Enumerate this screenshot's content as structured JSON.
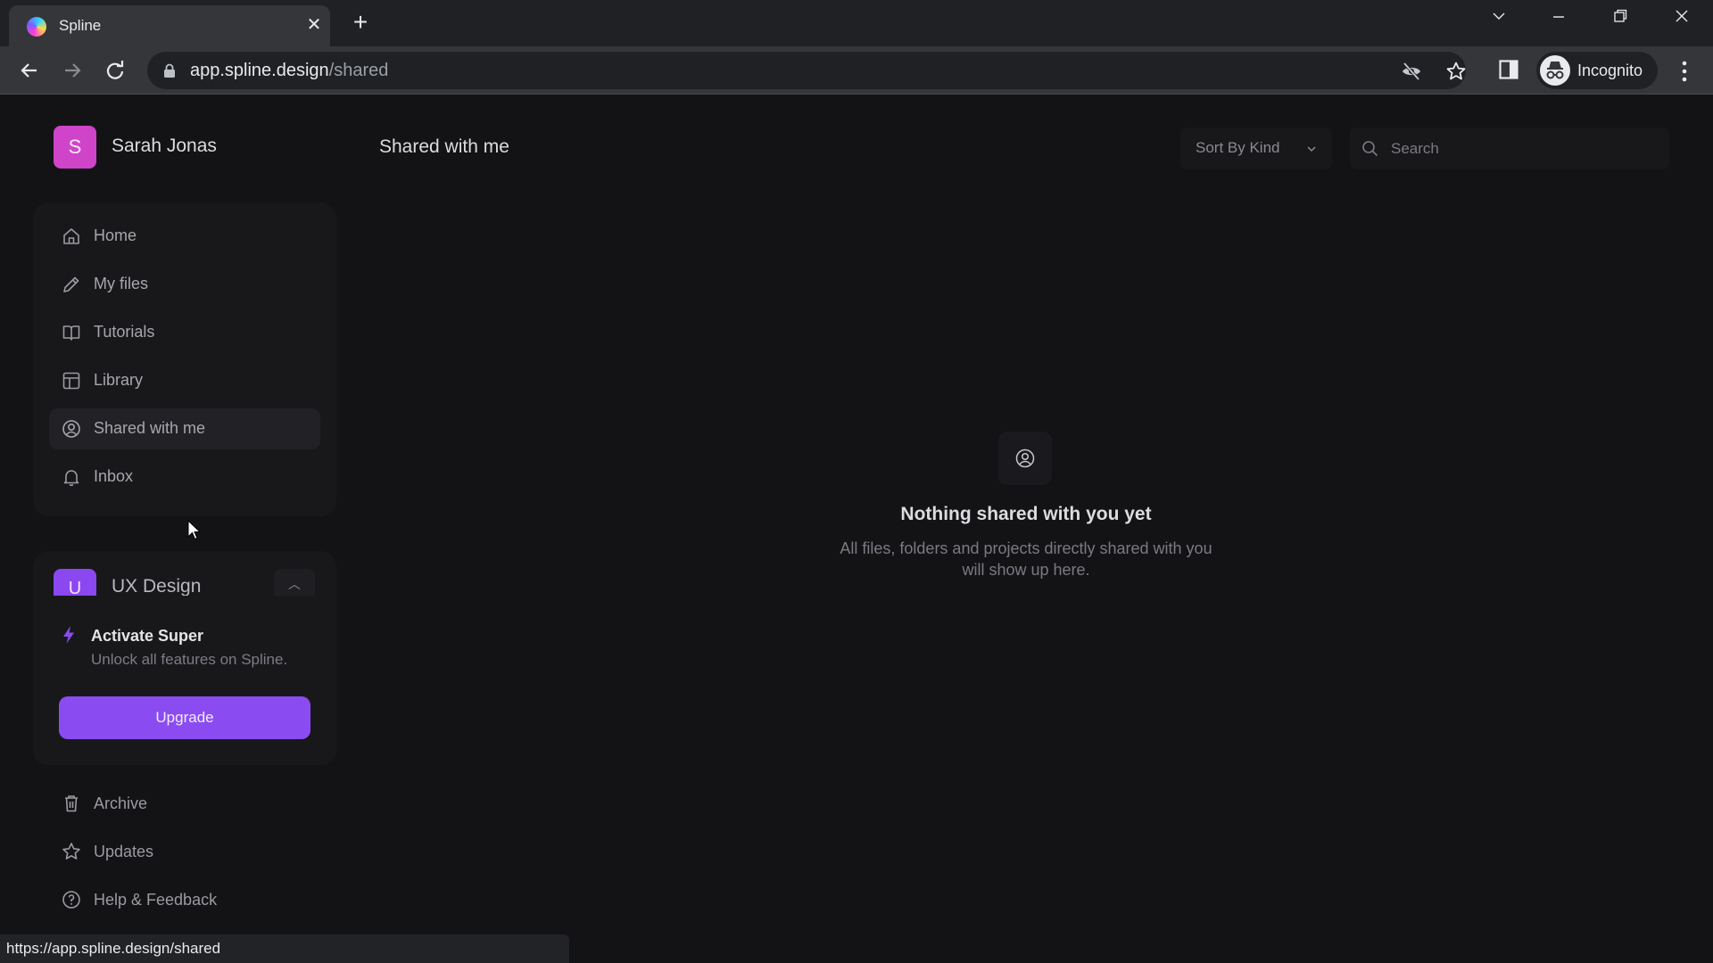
{
  "browser": {
    "tab_title": "Spline",
    "url_host": "app.spline.design",
    "url_path": "/shared",
    "profile_label": "Incognito",
    "status_url": "https://app.spline.design/shared",
    "icons": {
      "favicon": "spline-logo-icon",
      "back": "arrow-left-icon",
      "forward": "arrow-right-icon",
      "reload": "reload-icon",
      "lock": "lock-icon",
      "tracking": "eye-off-icon",
      "bookmark": "star-icon",
      "side_panel": "side-panel-icon",
      "menu": "kebab-menu-icon"
    }
  },
  "user": {
    "initial": "S",
    "name": "Sarah Jonas",
    "avatar_color": "#cf44c9"
  },
  "sidebar": {
    "nav_items": [
      {
        "label": "Home",
        "icon": "home-icon",
        "active": false
      },
      {
        "label": "My files",
        "icon": "pencil-icon",
        "active": false
      },
      {
        "label": "Tutorials",
        "icon": "book-icon",
        "active": false
      },
      {
        "label": "Library",
        "icon": "layout-icon",
        "active": false
      },
      {
        "label": "Shared with me",
        "icon": "user-circle-icon",
        "active": true
      },
      {
        "label": "Inbox",
        "icon": "bell-icon",
        "active": false
      }
    ],
    "team": {
      "initial": "U",
      "name": "UX Design",
      "avatar_color": "#8b47f0"
    },
    "upsell": {
      "title": "Activate Super",
      "description": "Unlock all features on Spline.",
      "button_label": "Upgrade",
      "accent": "#8a4cf0"
    },
    "footer_items": [
      {
        "label": "Archive",
        "icon": "trash-icon"
      },
      {
        "label": "Updates",
        "icon": "star-icon"
      },
      {
        "label": "Help & Feedback",
        "icon": "help-circle-icon"
      }
    ]
  },
  "main": {
    "title": "Shared with me",
    "sort": {
      "selected": "Sort By Kind"
    },
    "search": {
      "placeholder": "Search",
      "value": ""
    },
    "empty_state": {
      "icon": "user-circle-icon",
      "title": "Nothing shared with you yet",
      "description_line1": "All files, folders and projects directly shared with you",
      "description_line2": "will show up here."
    }
  }
}
